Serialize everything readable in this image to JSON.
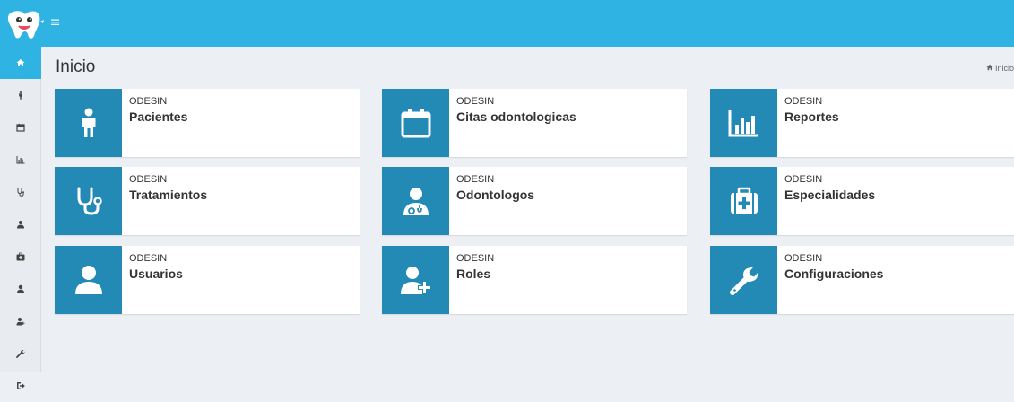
{
  "header": {
    "menu_icon": "hamburger-icon",
    "logo": "tooth-logo"
  },
  "sidebar": {
    "items": [
      {
        "icon": "home-icon",
        "active": true
      },
      {
        "icon": "male-icon"
      },
      {
        "icon": "calendar-icon"
      },
      {
        "icon": "bar-chart-icon"
      },
      {
        "icon": "stethoscope-icon"
      },
      {
        "icon": "user-md-icon"
      },
      {
        "icon": "medkit-icon"
      },
      {
        "icon": "user-icon"
      },
      {
        "icon": "user-plus-icon"
      },
      {
        "icon": "wrench-icon"
      },
      {
        "icon": "sign-out-icon"
      }
    ]
  },
  "page": {
    "title": "Inicio",
    "breadcrumb": "Inicio"
  },
  "tiles": [
    {
      "sub": "ODESIN",
      "label": "Pacientes",
      "icon": "male-icon"
    },
    {
      "sub": "ODESIN",
      "label": "Citas odontologicas",
      "icon": "calendar-icon"
    },
    {
      "sub": "ODESIN",
      "label": "Reportes",
      "icon": "bar-chart-icon"
    },
    {
      "sub": "ODESIN",
      "label": "Tratamientos",
      "icon": "stethoscope-icon"
    },
    {
      "sub": "ODESIN",
      "label": "Odontologos",
      "icon": "user-md-icon"
    },
    {
      "sub": "ODESIN",
      "label": "Especialidades",
      "icon": "medkit-icon"
    },
    {
      "sub": "ODESIN",
      "label": "Usuarios",
      "icon": "user-icon"
    },
    {
      "sub": "ODESIN",
      "label": "Roles",
      "icon": "user-plus-icon"
    },
    {
      "sub": "ODESIN",
      "label": "Configuraciones",
      "icon": "wrench-icon"
    }
  ],
  "colors": {
    "header": "#2fb3e3",
    "tile_icon_bg": "#2389b5",
    "background": "#ecf0f5"
  }
}
